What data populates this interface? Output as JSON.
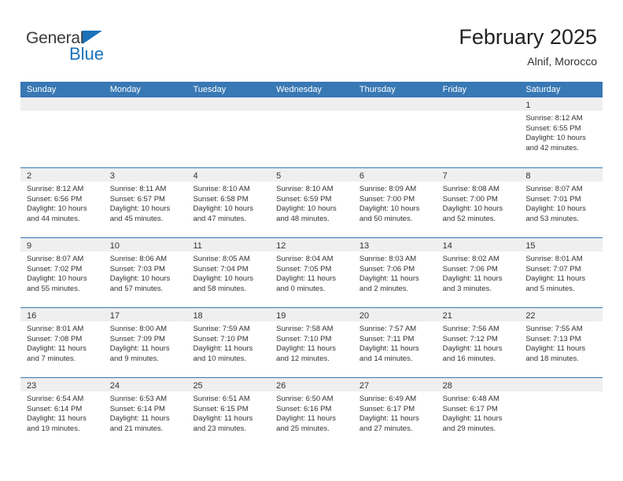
{
  "brand": {
    "word1": "General",
    "word2": "Blue",
    "triangle_color": "#1b72b8",
    "text_color": "#3a3a3a"
  },
  "header": {
    "title": "February 2025",
    "subtitle": "Alnif, Morocco"
  },
  "colors": {
    "header_blue": "#3878b4",
    "daynum_strip": "#efefef",
    "text": "#333333"
  },
  "weekdays": [
    "Sunday",
    "Monday",
    "Tuesday",
    "Wednesday",
    "Thursday",
    "Friday",
    "Saturday"
  ],
  "weeks": [
    [
      {
        "day": "",
        "sunrise": "",
        "sunset": "",
        "daylight_1": "",
        "daylight_2": ""
      },
      {
        "day": "",
        "sunrise": "",
        "sunset": "",
        "daylight_1": "",
        "daylight_2": ""
      },
      {
        "day": "",
        "sunrise": "",
        "sunset": "",
        "daylight_1": "",
        "daylight_2": ""
      },
      {
        "day": "",
        "sunrise": "",
        "sunset": "",
        "daylight_1": "",
        "daylight_2": ""
      },
      {
        "day": "",
        "sunrise": "",
        "sunset": "",
        "daylight_1": "",
        "daylight_2": ""
      },
      {
        "day": "",
        "sunrise": "",
        "sunset": "",
        "daylight_1": "",
        "daylight_2": ""
      },
      {
        "day": "1",
        "sunrise": "Sunrise: 8:12 AM",
        "sunset": "Sunset: 6:55 PM",
        "daylight_1": "Daylight: 10 hours",
        "daylight_2": "and 42 minutes."
      }
    ],
    [
      {
        "day": "2",
        "sunrise": "Sunrise: 8:12 AM",
        "sunset": "Sunset: 6:56 PM",
        "daylight_1": "Daylight: 10 hours",
        "daylight_2": "and 44 minutes."
      },
      {
        "day": "3",
        "sunrise": "Sunrise: 8:11 AM",
        "sunset": "Sunset: 6:57 PM",
        "daylight_1": "Daylight: 10 hours",
        "daylight_2": "and 45 minutes."
      },
      {
        "day": "4",
        "sunrise": "Sunrise: 8:10 AM",
        "sunset": "Sunset: 6:58 PM",
        "daylight_1": "Daylight: 10 hours",
        "daylight_2": "and 47 minutes."
      },
      {
        "day": "5",
        "sunrise": "Sunrise: 8:10 AM",
        "sunset": "Sunset: 6:59 PM",
        "daylight_1": "Daylight: 10 hours",
        "daylight_2": "and 48 minutes."
      },
      {
        "day": "6",
        "sunrise": "Sunrise: 8:09 AM",
        "sunset": "Sunset: 7:00 PM",
        "daylight_1": "Daylight: 10 hours",
        "daylight_2": "and 50 minutes."
      },
      {
        "day": "7",
        "sunrise": "Sunrise: 8:08 AM",
        "sunset": "Sunset: 7:00 PM",
        "daylight_1": "Daylight: 10 hours",
        "daylight_2": "and 52 minutes."
      },
      {
        "day": "8",
        "sunrise": "Sunrise: 8:07 AM",
        "sunset": "Sunset: 7:01 PM",
        "daylight_1": "Daylight: 10 hours",
        "daylight_2": "and 53 minutes."
      }
    ],
    [
      {
        "day": "9",
        "sunrise": "Sunrise: 8:07 AM",
        "sunset": "Sunset: 7:02 PM",
        "daylight_1": "Daylight: 10 hours",
        "daylight_2": "and 55 minutes."
      },
      {
        "day": "10",
        "sunrise": "Sunrise: 8:06 AM",
        "sunset": "Sunset: 7:03 PM",
        "daylight_1": "Daylight: 10 hours",
        "daylight_2": "and 57 minutes."
      },
      {
        "day": "11",
        "sunrise": "Sunrise: 8:05 AM",
        "sunset": "Sunset: 7:04 PM",
        "daylight_1": "Daylight: 10 hours",
        "daylight_2": "and 58 minutes."
      },
      {
        "day": "12",
        "sunrise": "Sunrise: 8:04 AM",
        "sunset": "Sunset: 7:05 PM",
        "daylight_1": "Daylight: 11 hours",
        "daylight_2": "and 0 minutes."
      },
      {
        "day": "13",
        "sunrise": "Sunrise: 8:03 AM",
        "sunset": "Sunset: 7:06 PM",
        "daylight_1": "Daylight: 11 hours",
        "daylight_2": "and 2 minutes."
      },
      {
        "day": "14",
        "sunrise": "Sunrise: 8:02 AM",
        "sunset": "Sunset: 7:06 PM",
        "daylight_1": "Daylight: 11 hours",
        "daylight_2": "and 3 minutes."
      },
      {
        "day": "15",
        "sunrise": "Sunrise: 8:01 AM",
        "sunset": "Sunset: 7:07 PM",
        "daylight_1": "Daylight: 11 hours",
        "daylight_2": "and 5 minutes."
      }
    ],
    [
      {
        "day": "16",
        "sunrise": "Sunrise: 8:01 AM",
        "sunset": "Sunset: 7:08 PM",
        "daylight_1": "Daylight: 11 hours",
        "daylight_2": "and 7 minutes."
      },
      {
        "day": "17",
        "sunrise": "Sunrise: 8:00 AM",
        "sunset": "Sunset: 7:09 PM",
        "daylight_1": "Daylight: 11 hours",
        "daylight_2": "and 9 minutes."
      },
      {
        "day": "18",
        "sunrise": "Sunrise: 7:59 AM",
        "sunset": "Sunset: 7:10 PM",
        "daylight_1": "Daylight: 11 hours",
        "daylight_2": "and 10 minutes."
      },
      {
        "day": "19",
        "sunrise": "Sunrise: 7:58 AM",
        "sunset": "Sunset: 7:10 PM",
        "daylight_1": "Daylight: 11 hours",
        "daylight_2": "and 12 minutes."
      },
      {
        "day": "20",
        "sunrise": "Sunrise: 7:57 AM",
        "sunset": "Sunset: 7:11 PM",
        "daylight_1": "Daylight: 11 hours",
        "daylight_2": "and 14 minutes."
      },
      {
        "day": "21",
        "sunrise": "Sunrise: 7:56 AM",
        "sunset": "Sunset: 7:12 PM",
        "daylight_1": "Daylight: 11 hours",
        "daylight_2": "and 16 minutes."
      },
      {
        "day": "22",
        "sunrise": "Sunrise: 7:55 AM",
        "sunset": "Sunset: 7:13 PM",
        "daylight_1": "Daylight: 11 hours",
        "daylight_2": "and 18 minutes."
      }
    ],
    [
      {
        "day": "23",
        "sunrise": "Sunrise: 6:54 AM",
        "sunset": "Sunset: 6:14 PM",
        "daylight_1": "Daylight: 11 hours",
        "daylight_2": "and 19 minutes."
      },
      {
        "day": "24",
        "sunrise": "Sunrise: 6:53 AM",
        "sunset": "Sunset: 6:14 PM",
        "daylight_1": "Daylight: 11 hours",
        "daylight_2": "and 21 minutes."
      },
      {
        "day": "25",
        "sunrise": "Sunrise: 6:51 AM",
        "sunset": "Sunset: 6:15 PM",
        "daylight_1": "Daylight: 11 hours",
        "daylight_2": "and 23 minutes."
      },
      {
        "day": "26",
        "sunrise": "Sunrise: 6:50 AM",
        "sunset": "Sunset: 6:16 PM",
        "daylight_1": "Daylight: 11 hours",
        "daylight_2": "and 25 minutes."
      },
      {
        "day": "27",
        "sunrise": "Sunrise: 6:49 AM",
        "sunset": "Sunset: 6:17 PM",
        "daylight_1": "Daylight: 11 hours",
        "daylight_2": "and 27 minutes."
      },
      {
        "day": "28",
        "sunrise": "Sunrise: 6:48 AM",
        "sunset": "Sunset: 6:17 PM",
        "daylight_1": "Daylight: 11 hours",
        "daylight_2": "and 29 minutes."
      },
      {
        "day": "",
        "sunrise": "",
        "sunset": "",
        "daylight_1": "",
        "daylight_2": ""
      }
    ]
  ]
}
